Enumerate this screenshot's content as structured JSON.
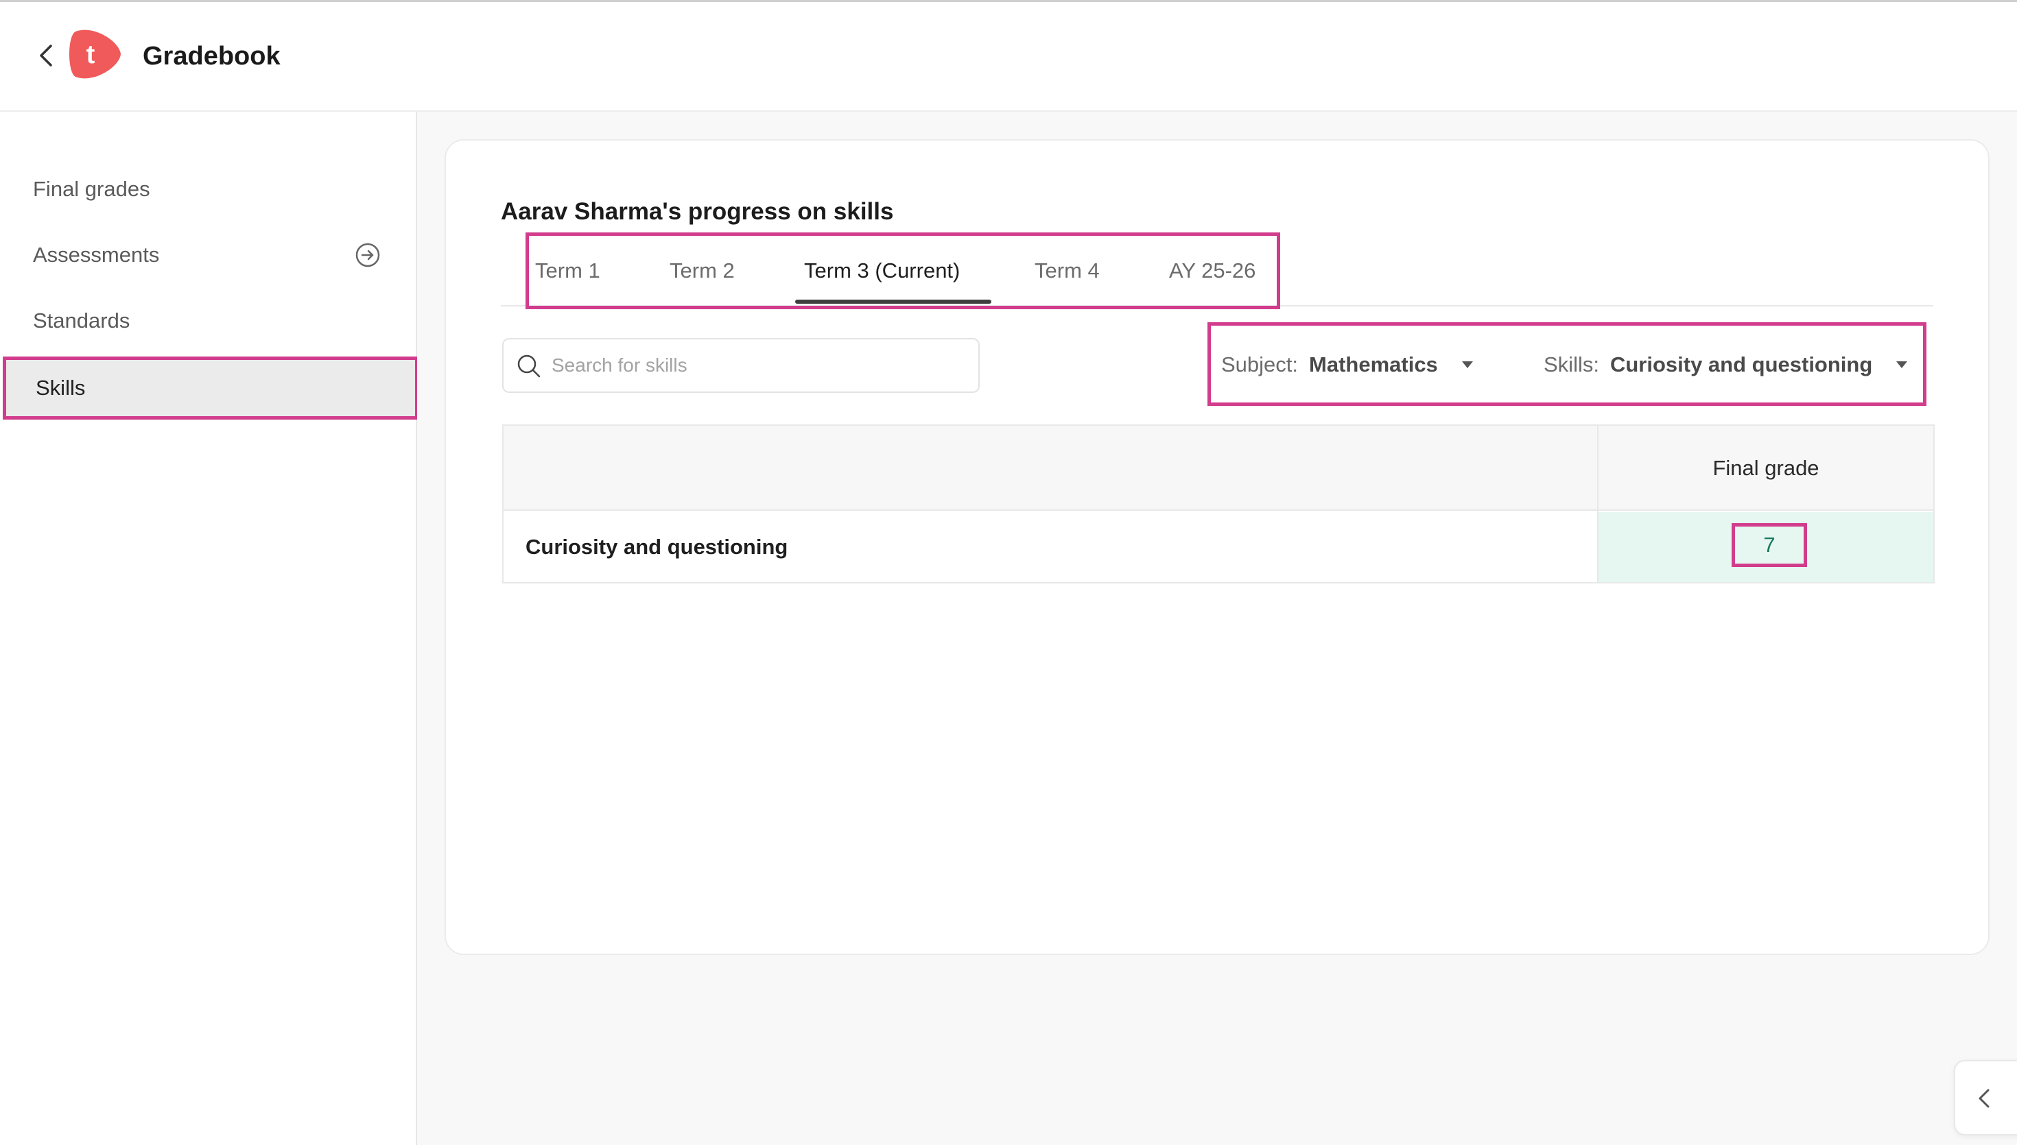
{
  "header": {
    "title": "Gradebook",
    "logo_letter": "t",
    "brand_color": "#f05a5a"
  },
  "sidebar": {
    "items": [
      {
        "label": "Final grades",
        "active": false
      },
      {
        "label": "Assessments",
        "active": false,
        "icon": "arrow-circle-right-icon"
      },
      {
        "label": "Standards",
        "active": false
      },
      {
        "label": "Skills",
        "active": true
      }
    ]
  },
  "main": {
    "title": "Aarav Sharma's progress on skills",
    "tabs": [
      {
        "label": "Term 1",
        "active": false
      },
      {
        "label": "Term 2",
        "active": false
      },
      {
        "label": "Term 3 (Current)",
        "active": true
      },
      {
        "label": "Term 4",
        "active": false
      },
      {
        "label": "AY 25-26",
        "active": false
      }
    ],
    "search": {
      "placeholder": "Search for skills",
      "value": ""
    },
    "filters": {
      "subject_label": "Subject:",
      "subject_value": "Mathematics",
      "skills_label": "Skills:",
      "skills_value": "Curiosity and questioning"
    },
    "table": {
      "columns": [
        "",
        "Final grade"
      ],
      "rows": [
        {
          "skill": "Curiosity and questioning",
          "final_grade": "7"
        }
      ]
    }
  },
  "colors": {
    "highlight": "#d23c8c",
    "grade_cell_bg": "#e6f7f1",
    "grade_text": "#167a5c"
  }
}
